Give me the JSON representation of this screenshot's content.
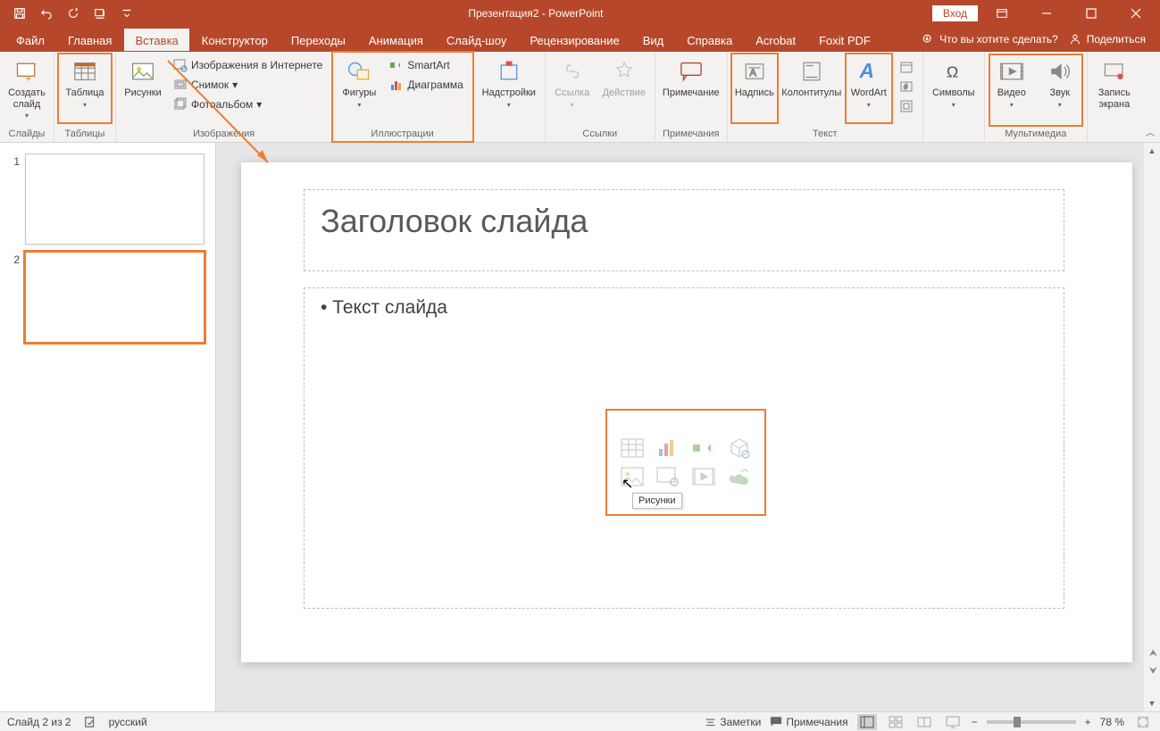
{
  "colors": {
    "brand": "#b7472a",
    "accent": "#ed7d31"
  },
  "titlebar": {
    "title": "Презентация2 - PowerPoint",
    "login": "Вход"
  },
  "tabs": {
    "items": [
      "Файл",
      "Главная",
      "Вставка",
      "Конструктор",
      "Переходы",
      "Анимация",
      "Слайд-шоу",
      "Рецензирование",
      "Вид",
      "Справка",
      "Acrobat",
      "Foxit PDF"
    ],
    "active_index": 2,
    "tell_me": "Что вы хотите сделать?",
    "share": "Поделиться"
  },
  "ribbon": {
    "groups": {
      "slides": {
        "label": "Слайды",
        "new_slide": "Создать слайд"
      },
      "tables": {
        "label": "Таблицы",
        "table": "Таблица"
      },
      "images": {
        "label": "Изображения",
        "pictures": "Рисунки",
        "online": "Изображения в Интернете",
        "screenshot": "Снимок",
        "album": "Фотоальбом"
      },
      "illustrations": {
        "label": "Иллюстрации",
        "shapes": "Фигуры",
        "smartart": "SmartArt",
        "chart": "Диаграмма"
      },
      "addins": {
        "label": "",
        "addins": "Надстройки"
      },
      "links": {
        "label": "Ссылки",
        "link": "Ссылка",
        "action": "Действие"
      },
      "comments": {
        "label": "Примечания",
        "comment": "Примечание"
      },
      "text": {
        "label": "Текст",
        "textbox": "Надпись",
        "header": "Колонтитулы",
        "wordart": "WordArt"
      },
      "symbols": {
        "label": "",
        "symbols": "Символы"
      },
      "media": {
        "label": "Мультимедиа",
        "video": "Видео",
        "audio": "Звук",
        "record": "Запись экрана"
      }
    }
  },
  "slides_panel": {
    "items": [
      {
        "num": "1"
      },
      {
        "num": "2"
      }
    ],
    "selected_index": 1
  },
  "slide": {
    "title_placeholder": "Заголовок слайда",
    "body_placeholder": "Текст слайда",
    "tooltip": "Рисунки"
  },
  "statusbar": {
    "slide_info": "Слайд 2 из 2",
    "language": "русский",
    "notes": "Заметки",
    "comments": "Примечания",
    "zoom": "78 %"
  }
}
